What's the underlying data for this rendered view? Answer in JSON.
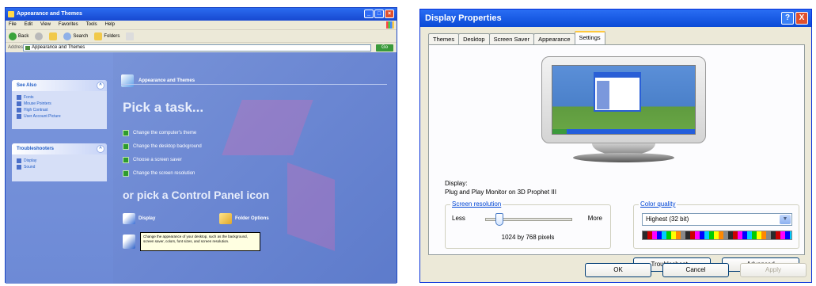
{
  "left_window": {
    "title": "Appearance and Themes",
    "menu": [
      "File",
      "Edit",
      "View",
      "Favorites",
      "Tools",
      "Help"
    ],
    "toolbar": {
      "back_label": "Back",
      "search_label": "Search",
      "folders_label": "Folders"
    },
    "address": {
      "label": "Address",
      "value": "Appearance and Themes",
      "go_label": "Go"
    },
    "see_also": {
      "title": "See Also",
      "items": [
        "Fonts",
        "Mouse Pointers",
        "High Contrast",
        "User Account Picture"
      ]
    },
    "troubleshooters": {
      "title": "Troubleshooters",
      "items": [
        "Display",
        "Sound"
      ]
    },
    "header": "Appearance and Themes",
    "pick_task": "Pick a task...",
    "tasks": [
      "Change the computer's theme",
      "Change the desktop background",
      "Choose a screen saver",
      "Change the screen resolution"
    ],
    "or_pick": "or pick a Control Panel icon",
    "icons": {
      "display": "Display",
      "folder_options": "Folder Options"
    },
    "tooltip": "Change the appearance of your desktop, such as the background, screen saver, colors, font sizes, and screen resolution."
  },
  "right_window": {
    "title": "Display Properties",
    "help_label": "?",
    "close_label": "X",
    "tabs": [
      "Themes",
      "Desktop",
      "Screen Saver",
      "Appearance",
      "Settings"
    ],
    "display_label": "Display:",
    "display_value": "Plug and Play Monitor on 3D Prophet III",
    "resolution": {
      "title": "Screen resolution",
      "less": "Less",
      "more": "More",
      "value_text": "1024 by 768 pixels",
      "slider_level": 0.12
    },
    "color_quality": {
      "title": "Color quality",
      "selected": "Highest (32 bit)"
    },
    "buttons": {
      "troubleshoot": "Troubleshoot...",
      "advanced": "Advanced",
      "ok": "OK",
      "cancel": "Cancel",
      "apply": "Apply"
    }
  }
}
